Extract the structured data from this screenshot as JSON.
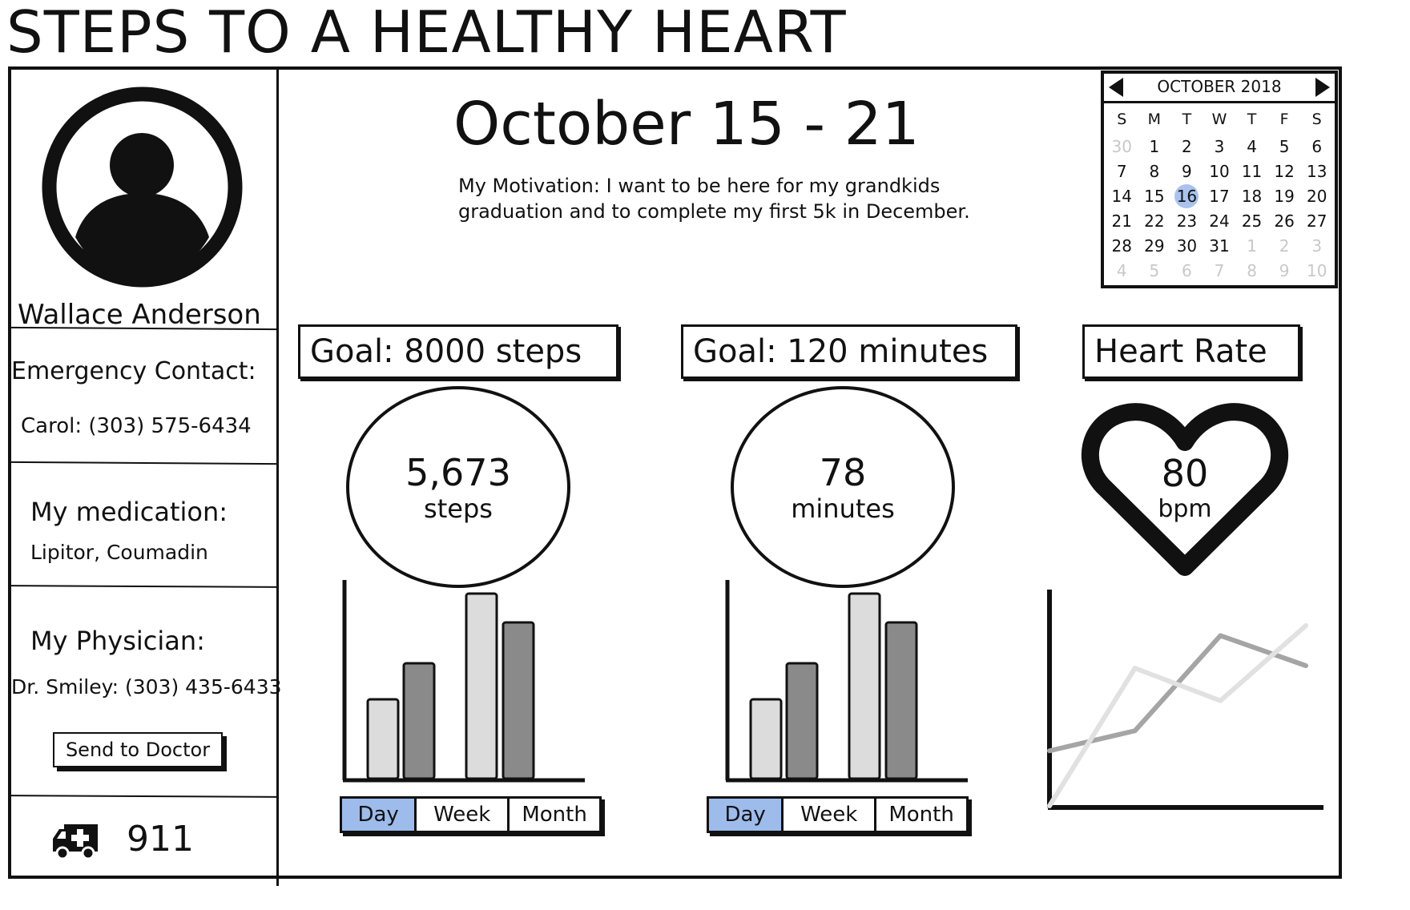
{
  "app": {
    "title": "STEPS TO A HEALTHY HEART"
  },
  "profile": {
    "name": "Wallace Anderson",
    "emergency_label": "Emergency Contact:",
    "emergency_value": "Carol: (303) 575-6434",
    "medication_label": "My medication:",
    "medication_value": "Lipitor, Coumadin",
    "physician_label": "My Physician:",
    "physician_value": "Dr. Smiley: (303) 435-6433",
    "send_button": "Send to Doctor",
    "emergency_number": "911"
  },
  "week": {
    "title": "October 15 - 21",
    "motivation_line1": "My Motivation: I want to be here for my grandkids",
    "motivation_line2": "graduation and to complete my first 5k in December."
  },
  "calendar": {
    "month": "OCTOBER 2018",
    "dow": [
      "S",
      "M",
      "T",
      "W",
      "T",
      "F",
      "S"
    ],
    "selected": "16",
    "days": [
      {
        "d": "30",
        "m": true
      },
      {
        "d": "1"
      },
      {
        "d": "2"
      },
      {
        "d": "3"
      },
      {
        "d": "4"
      },
      {
        "d": "5"
      },
      {
        "d": "6"
      },
      {
        "d": "7"
      },
      {
        "d": "8"
      },
      {
        "d": "9"
      },
      {
        "d": "10"
      },
      {
        "d": "11"
      },
      {
        "d": "12"
      },
      {
        "d": "13"
      },
      {
        "d": "14"
      },
      {
        "d": "15"
      },
      {
        "d": "16"
      },
      {
        "d": "17"
      },
      {
        "d": "18"
      },
      {
        "d": "19"
      },
      {
        "d": "20"
      },
      {
        "d": "21"
      },
      {
        "d": "22"
      },
      {
        "d": "23"
      },
      {
        "d": "24"
      },
      {
        "d": "25"
      },
      {
        "d": "26"
      },
      {
        "d": "27"
      },
      {
        "d": "28"
      },
      {
        "d": "29"
      },
      {
        "d": "30"
      },
      {
        "d": "31"
      },
      {
        "d": "1",
        "m": true
      },
      {
        "d": "2",
        "m": true
      },
      {
        "d": "3",
        "m": true
      },
      {
        "d": "4",
        "m": true
      },
      {
        "d": "5",
        "m": true
      },
      {
        "d": "6",
        "m": true
      },
      {
        "d": "7",
        "m": true
      },
      {
        "d": "8",
        "m": true
      },
      {
        "d": "9",
        "m": true
      },
      {
        "d": "10",
        "m": true
      }
    ]
  },
  "steps": {
    "goal": "Goal: 8000 steps",
    "value": "5,673",
    "unit": "steps",
    "tabs": [
      "Day",
      "Week",
      "Month"
    ],
    "active_tab": "Day"
  },
  "minutes": {
    "goal": "Goal: 120 minutes",
    "value": "78",
    "unit": "minutes",
    "tabs": [
      "Day",
      "Week",
      "Month"
    ],
    "active_tab": "Day"
  },
  "heart_rate": {
    "label": "Heart Rate",
    "value": "80",
    "unit": "bpm"
  },
  "colors": {
    "bar_light": "#dcdcdc",
    "bar_dark": "#8a8a8a",
    "line_light": "#e1e1e1",
    "line_dark": "#a5a5a5",
    "active_tab": "#9dbcec",
    "selected_day": "#a9c3ee"
  },
  "chart_data": [
    {
      "type": "bar",
      "series": [
        {
          "name": "",
          "values": [
            33,
            48,
            77,
            65
          ]
        }
      ],
      "categories": [
        "",
        "",
        "",
        ""
      ],
      "ylim": [
        0,
        80
      ],
      "grid": false
    },
    {
      "type": "bar",
      "series": [
        {
          "name": "",
          "values": [
            33,
            48,
            77,
            65
          ]
        }
      ],
      "categories": [
        "",
        "",
        "",
        ""
      ],
      "ylim": [
        0,
        80
      ],
      "grid": false
    },
    {
      "type": "line",
      "x": [
        0,
        1,
        2,
        3
      ],
      "series": [
        {
          "name": "",
          "values": [
            22,
            30,
            68,
            56
          ]
        },
        {
          "name": "",
          "values": [
            0,
            55,
            42,
            72
          ]
        }
      ],
      "ylim": [
        0,
        80
      ],
      "grid": false
    }
  ]
}
